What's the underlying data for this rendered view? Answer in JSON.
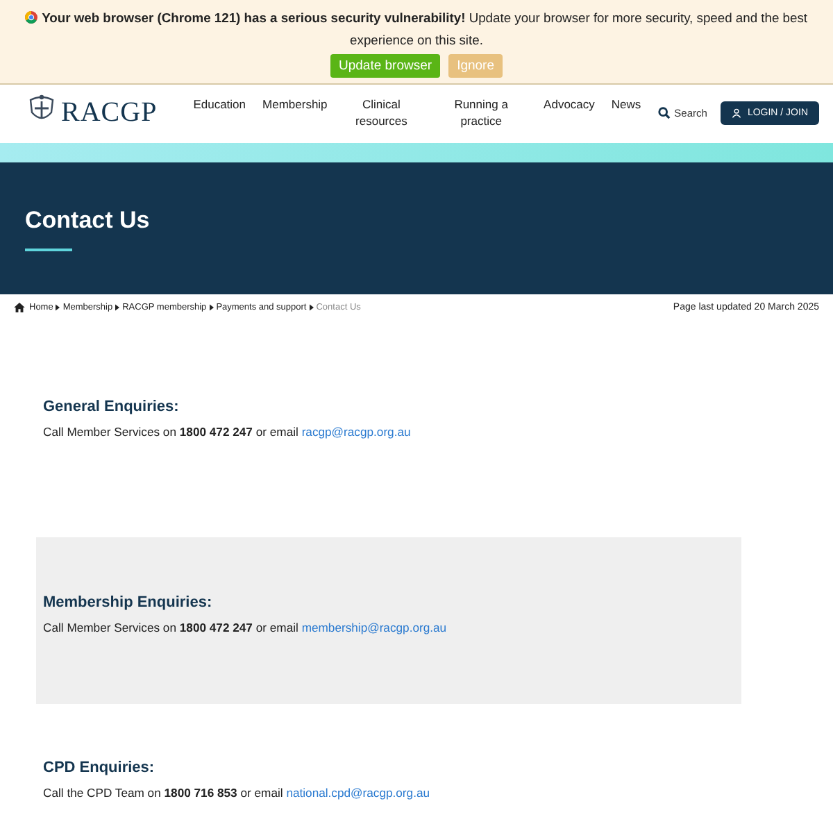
{
  "banner": {
    "message": "**Your web browser (Chrome 121) has a serious security vulnerability!** Update your browser for more security, speed and the best experience on this site.",
    "buttons": [
      {
        "label": "Update browser",
        "kind": "primary"
      },
      {
        "label": "Ignore",
        "kind": "secondary"
      }
    ]
  },
  "header": {
    "logo": "RACGP",
    "nav": [
      {
        "label": "Education"
      },
      {
        "label": "Membership"
      },
      {
        "label": "Clinical resources"
      },
      {
        "label": "Running a practice"
      },
      {
        "label": "Advocacy"
      },
      {
        "label": "News"
      }
    ],
    "search": "Search",
    "login": "LOGIN / JOIN"
  },
  "hero": {
    "title": "Contact Us"
  },
  "breadcrumb": {
    "items": [
      {
        "label": "Home",
        "current": false
      },
      {
        "label": "Membership",
        "current": false
      },
      {
        "label": "RACGP membership",
        "current": false
      },
      {
        "label": "Payments and support",
        "current": false
      },
      {
        "label": "Contact Us",
        "current": true
      }
    ],
    "updated": "Page last updated 20 March 2025"
  },
  "sections": [
    {
      "heading": "General Enquiries:",
      "text": "Call Member Services on **1800 472 247** or email ",
      "email": "racgp@racgp.org.au",
      "shaded": false
    },
    {
      "heading": "Membership Enquiries:",
      "text": "Call Member Services on **1800 472 247** or email ",
      "email": "membership@racgp.org.au",
      "shaded": true
    },
    {
      "heading": "CPD Enquiries:",
      "text": "Call the CPD Team on **1800 716 853** or email ",
      "email": "national.cpd@racgp.org.au",
      "shaded": false
    }
  ]
}
